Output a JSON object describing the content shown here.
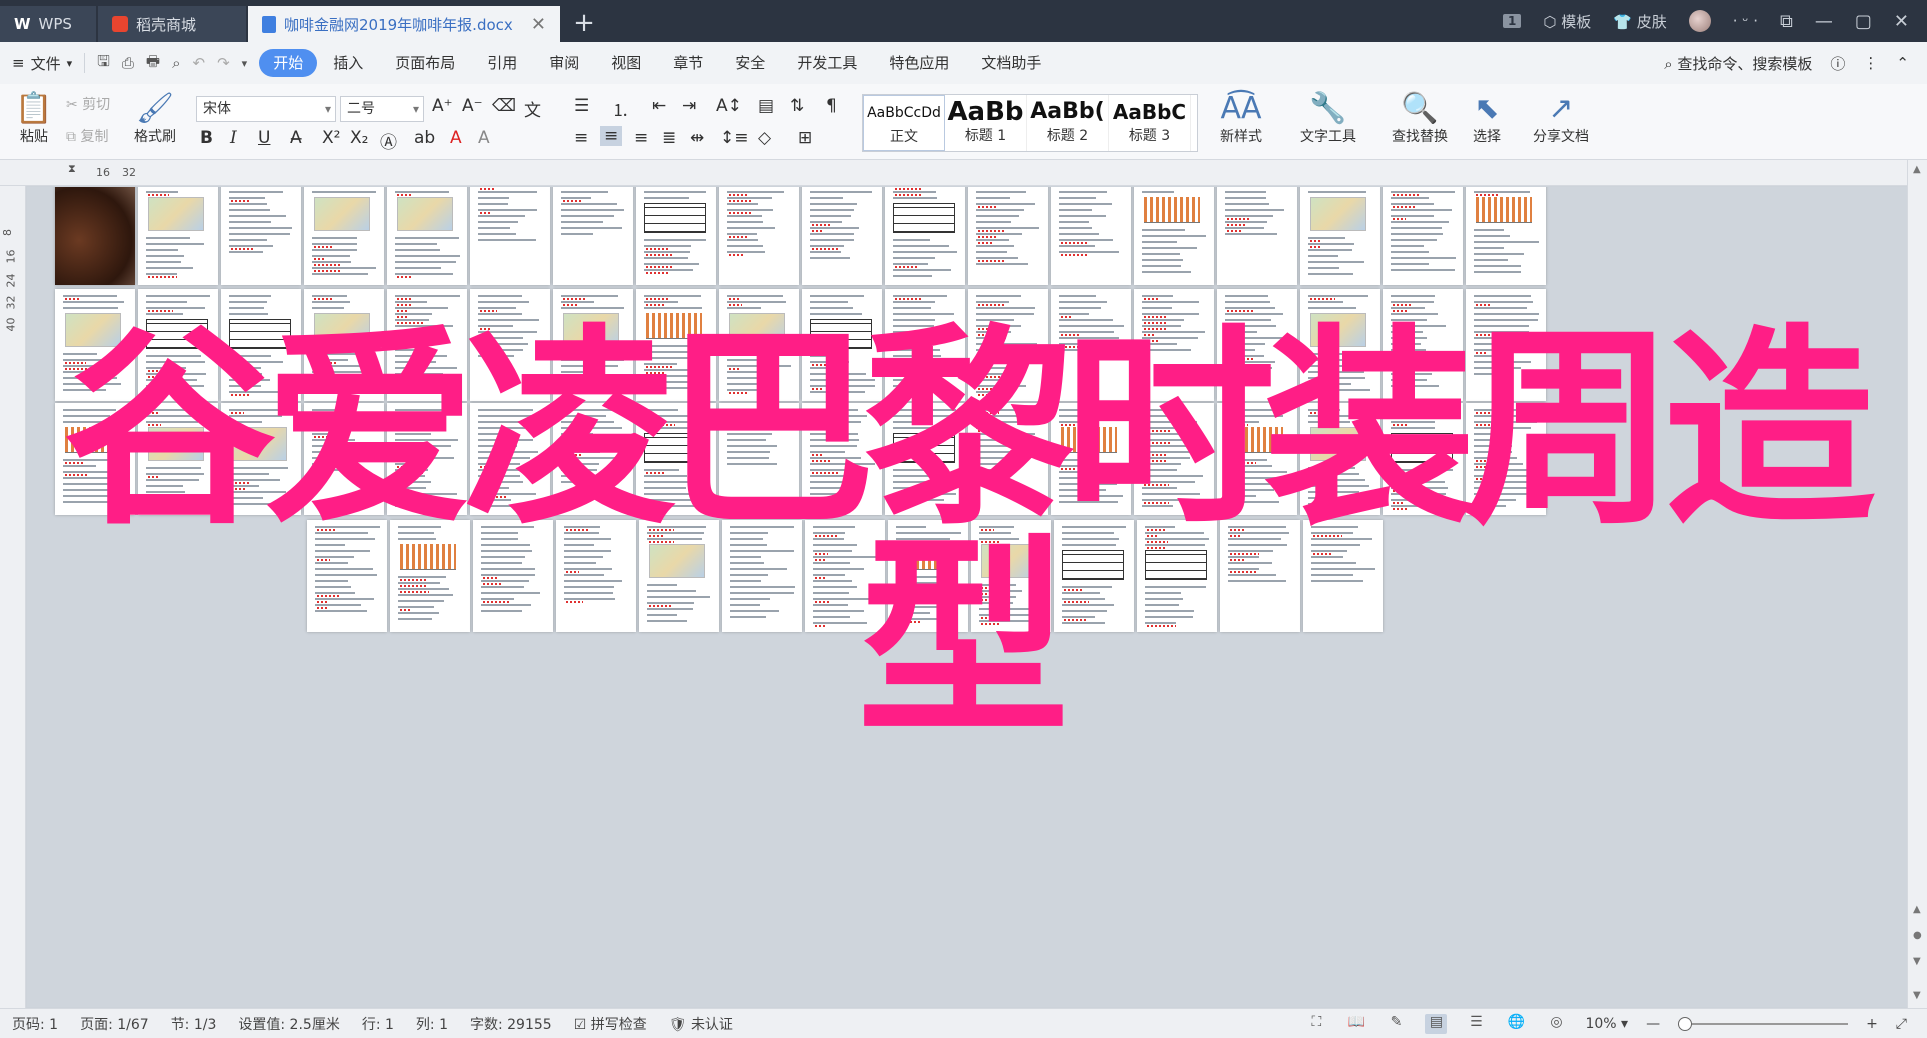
{
  "titlebar": {
    "tabs": [
      {
        "label": "WPS"
      },
      {
        "label": "稻壳商城"
      },
      {
        "label": "咖啡金融网2019年咖啡年报.docx"
      }
    ],
    "window_count": "1",
    "template_label": "模板",
    "skin_label": "皮肤"
  },
  "menubar": {
    "file_label": "文件",
    "items": [
      "开始",
      "插入",
      "页面布局",
      "引用",
      "审阅",
      "视图",
      "章节",
      "安全",
      "开发工具",
      "特色应用",
      "文档助手"
    ],
    "active": "开始",
    "search_placeholder": "查找命令、搜索模板"
  },
  "ribbon": {
    "paste": "粘贴",
    "cut": "剪切",
    "copy": "复制",
    "format_painter": "格式刷",
    "font_name": "宋体",
    "font_size": "二号",
    "styles": [
      {
        "sample": "AaBbCcDd",
        "name": "正文"
      },
      {
        "sample": "AaBb",
        "name": "标题 1"
      },
      {
        "sample": "AaBb(",
        "name": "标题 2"
      },
      {
        "sample": "AaBbC",
        "name": "标题 3"
      }
    ],
    "new_style": "新样式",
    "text_tools": "文字工具",
    "find_replace": "查找替换",
    "select": "选择",
    "share": "分享文档"
  },
  "ruler": {
    "top_marks": [
      "16",
      "32"
    ],
    "left_marks": [
      "8",
      "16",
      "24",
      "32",
      "40"
    ]
  },
  "overlay": {
    "line1": "谷爱凌巴黎时装周造",
    "line2": "型"
  },
  "statusbar": {
    "page_code": "页码: 1",
    "page": "页面: 1/67",
    "section": "节: 1/3",
    "setting": "设置值: 2.5厘米",
    "row": "行: 1",
    "col": "列: 1",
    "word_count": "字数: 29155",
    "spell_check": "拼写检查",
    "unverified": "未认证",
    "zoom": "10%"
  },
  "colors": {
    "overlay_text": "#ff1e86",
    "accent": "#4f8ff0",
    "titlebar": "#2c3441"
  }
}
